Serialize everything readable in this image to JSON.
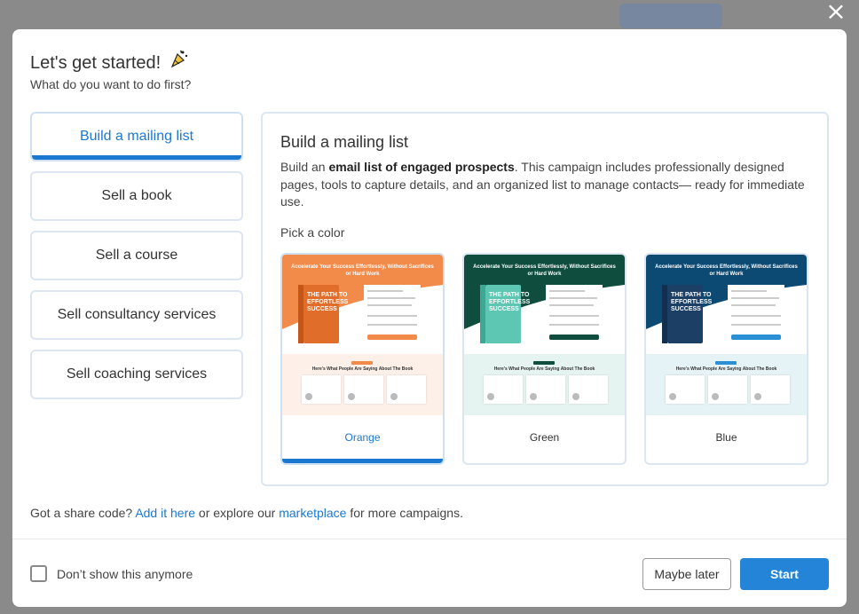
{
  "dialog": {
    "title": "Let's get started!",
    "subtitle": "What do you want to do first?",
    "close_glyph": "×"
  },
  "options": [
    {
      "label": "Build a mailing list",
      "selected": true
    },
    {
      "label": "Sell a book",
      "selected": false
    },
    {
      "label": "Sell a course",
      "selected": false
    },
    {
      "label": "Sell consultancy services",
      "selected": false
    },
    {
      "label": "Sell coaching services",
      "selected": false
    }
  ],
  "panel": {
    "heading": "Build a mailing list",
    "desc_before": "Build an ",
    "desc_bold": "email list of engaged prospects",
    "desc_after": ". This campaign includes professionally designed pages, tools to capture details, and an organized list to manage contacts— ready for immediate use.",
    "pick_label": "Pick a color"
  },
  "colors": [
    {
      "name": "Orange",
      "selected": true,
      "primary": "#f28a4a",
      "dark": "#e06d2a",
      "light": "#fdf0e8"
    },
    {
      "name": "Green",
      "selected": false,
      "primary": "#0f4d3f",
      "dark": "#5ec7b3",
      "light": "#e6f4f1"
    },
    {
      "name": "Blue",
      "selected": false,
      "primary": "#0d4a73",
      "dark": "#1c3f66",
      "light": "#e5f2f6"
    }
  ],
  "preview": {
    "headline": "Accelerate Your Success Effortlessly, Without Sacrifices or Hard Work",
    "book_title": "THE PATH TO EFFORTLESS SUCCESS",
    "testimonials_heading": "Here's What People Are Saying About The Book"
  },
  "share": {
    "prefix": "Got a share code? ",
    "link1": "Add it here",
    "middle": " or explore our ",
    "link2": "marketplace",
    "suffix": " for more campaigns."
  },
  "footer": {
    "dont_show": "Don’t show this anymore",
    "maybe_later": "Maybe later",
    "start": "Start"
  },
  "accent_color": "#1b78d0"
}
